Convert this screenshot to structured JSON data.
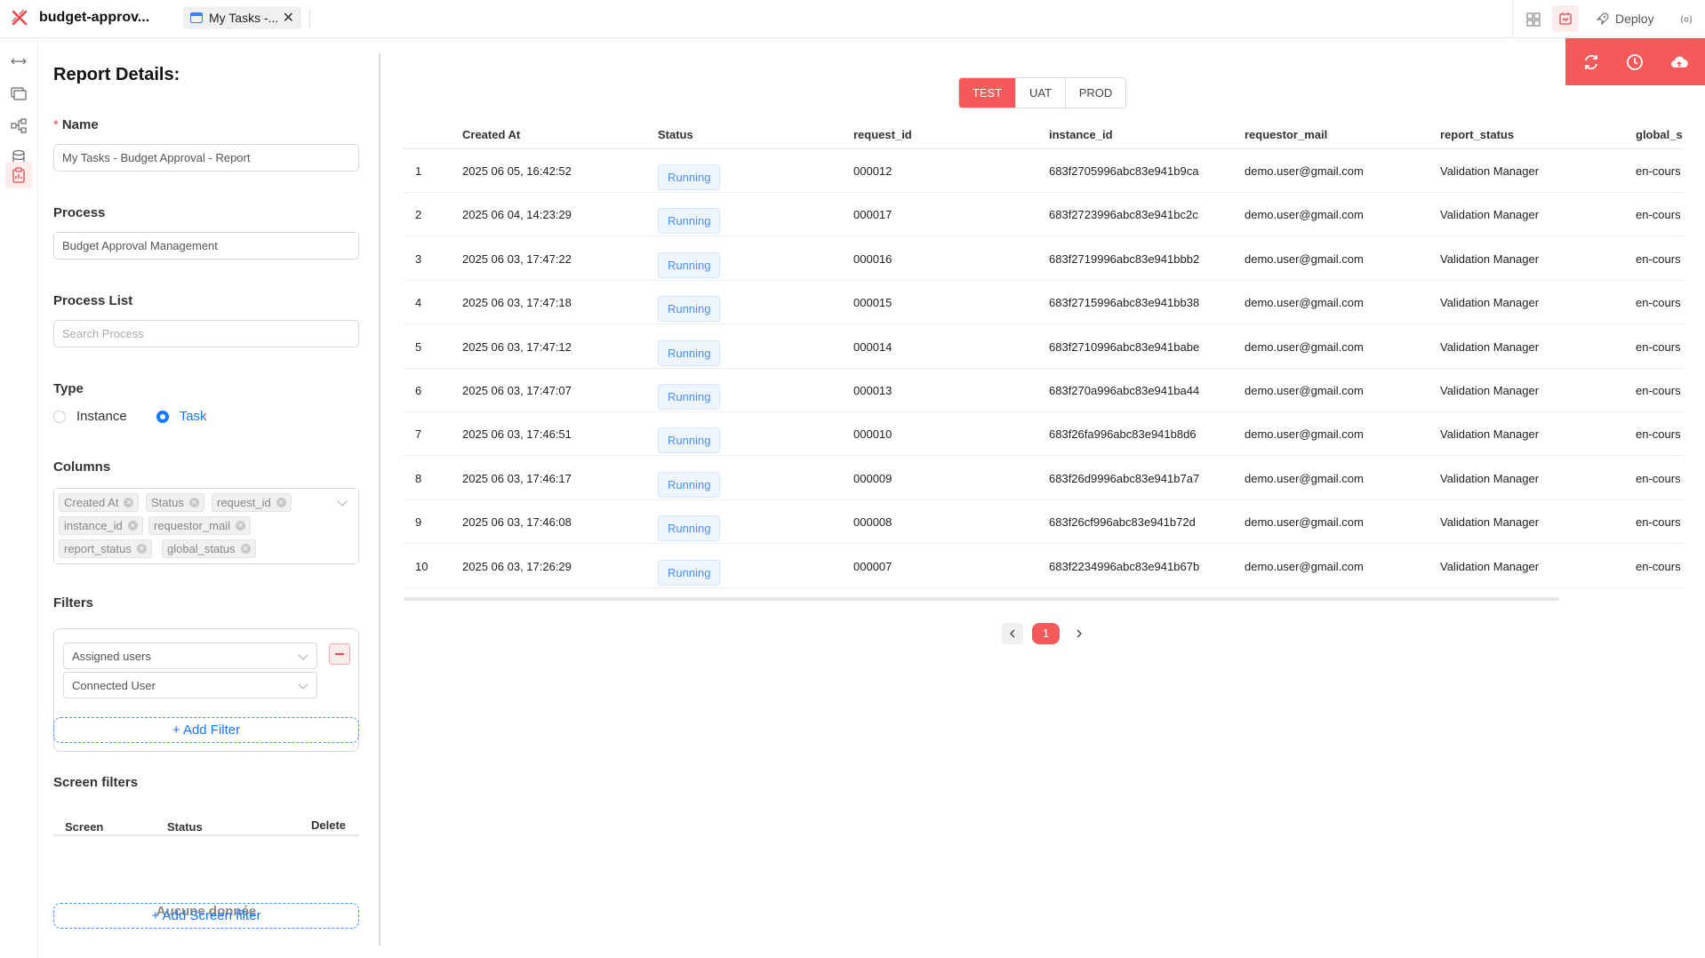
{
  "app": {
    "title": "budget-approv..."
  },
  "tab": {
    "label": "My Tasks -...",
    "close": "✕"
  },
  "toolbar": {
    "deploy_label": "Deploy"
  },
  "panel": {
    "title": "Report Details:",
    "name_label": "Name",
    "name_required": "*",
    "name_value": "My Tasks - Budget Approval - Report",
    "process_label": "Process",
    "process_value": "Budget Approval Management",
    "process_list_label": "Process List",
    "process_list_placeholder": "Search Process",
    "type_label": "Type",
    "type_options": [
      "Instance",
      "Task"
    ],
    "type_selected": "Task",
    "columns_label": "Columns",
    "columns": [
      "Created At",
      "Status",
      "request_id",
      "instance_id",
      "requestor_mail",
      "report_status",
      "global_status"
    ],
    "filters_label": "Filters",
    "filters": [
      "Assigned users",
      "Connected User"
    ],
    "add_filter": "+ Add Filter",
    "screen_filters_label": "Screen filters",
    "screen_filters_headers": [
      "Screen",
      "Status",
      "Delete"
    ],
    "empty_text": "Aucune donnée",
    "add_screen_filter": "+ Add Screen filter"
  },
  "environments": {
    "options": [
      "TEST",
      "UAT",
      "PROD"
    ],
    "selected": "TEST"
  },
  "table": {
    "headers": [
      "Created At",
      "Status",
      "request_id",
      "instance_id",
      "requestor_mail",
      "report_status",
      "global_s"
    ],
    "rows": [
      {
        "n": "1",
        "created": "2025 06 05, 16:42:52",
        "status": "Running",
        "request_id": "000012",
        "instance_id": "683f2705996abc83e941b9ca",
        "mail": "demo.user@gmail.com",
        "report": "Validation Manager",
        "global": "en-cours"
      },
      {
        "n": "2",
        "created": "2025 06 04, 14:23:29",
        "status": "Running",
        "request_id": "000017",
        "instance_id": "683f2723996abc83e941bc2c",
        "mail": "demo.user@gmail.com",
        "report": "Validation Manager",
        "global": "en-cours"
      },
      {
        "n": "3",
        "created": "2025 06 03, 17:47:22",
        "status": "Running",
        "request_id": "000016",
        "instance_id": "683f2719996abc83e941bbb2",
        "mail": "demo.user@gmail.com",
        "report": "Validation Manager",
        "global": "en-cours"
      },
      {
        "n": "4",
        "created": "2025 06 03, 17:47:18",
        "status": "Running",
        "request_id": "000015",
        "instance_id": "683f2715996abc83e941bb38",
        "mail": "demo.user@gmail.com",
        "report": "Validation Manager",
        "global": "en-cours"
      },
      {
        "n": "5",
        "created": "2025 06 03, 17:47:12",
        "status": "Running",
        "request_id": "000014",
        "instance_id": "683f2710996abc83e941babe",
        "mail": "demo.user@gmail.com",
        "report": "Validation Manager",
        "global": "en-cours"
      },
      {
        "n": "6",
        "created": "2025 06 03, 17:47:07",
        "status": "Running",
        "request_id": "000013",
        "instance_id": "683f270a996abc83e941ba44",
        "mail": "demo.user@gmail.com",
        "report": "Validation Manager",
        "global": "en-cours"
      },
      {
        "n": "7",
        "created": "2025 06 03, 17:46:51",
        "status": "Running",
        "request_id": "000010",
        "instance_id": "683f26fa996abc83e941b8d6",
        "mail": "demo.user@gmail.com",
        "report": "Validation Manager",
        "global": "en-cours"
      },
      {
        "n": "8",
        "created": "2025 06 03, 17:46:17",
        "status": "Running",
        "request_id": "000009",
        "instance_id": "683f26d9996abc83e941b7a7",
        "mail": "demo.user@gmail.com",
        "report": "Validation Manager",
        "global": "en-cours"
      },
      {
        "n": "9",
        "created": "2025 06 03, 17:46:08",
        "status": "Running",
        "request_id": "000008",
        "instance_id": "683f26cf996abc83e941b72d",
        "mail": "demo.user@gmail.com",
        "report": "Validation Manager",
        "global": "en-cours"
      },
      {
        "n": "10",
        "created": "2025 06 03, 17:26:29",
        "status": "Running",
        "request_id": "000007",
        "instance_id": "683f2234996abc83e941b67b",
        "mail": "demo.user@gmail.com",
        "report": "Validation Manager",
        "global": "en-cours"
      }
    ]
  },
  "pagination": {
    "current": "1"
  },
  "colors": {
    "accent": "#f55a5a",
    "link": "#1677ff",
    "badge_text": "#4b8ff5"
  }
}
